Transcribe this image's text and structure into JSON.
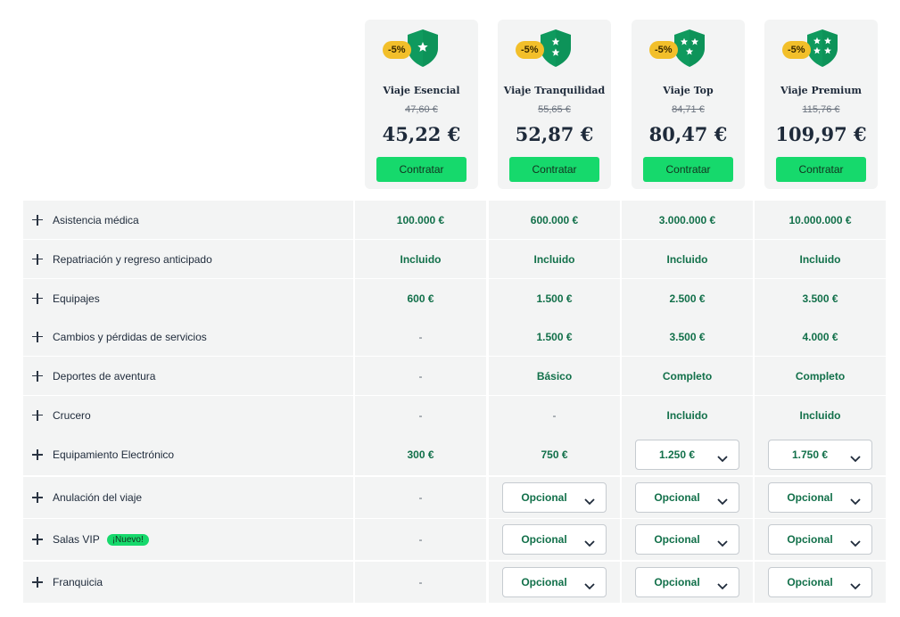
{
  "plans": [
    {
      "discount": "-5%",
      "icon": "shield-one-star-icon",
      "name": "Viaje Esencial",
      "old_price": "47,60 €",
      "price": "45,22 €",
      "cta": "Contratar"
    },
    {
      "discount": "-5%",
      "icon": "shield-two-stars-icon",
      "name": "Viaje Tranquilidad",
      "old_price": "55,65 €",
      "price": "52,87 €",
      "cta": "Contratar"
    },
    {
      "discount": "-5%",
      "icon": "shield-three-stars-icon",
      "name": "Viaje Top",
      "old_price": "84,71 €",
      "price": "80,47 €",
      "cta": "Contratar"
    },
    {
      "discount": "-5%",
      "icon": "shield-four-stars-icon",
      "name": "Viaje Premium",
      "old_price": "115,76 €",
      "price": "109,97 €",
      "cta": "Contratar"
    }
  ],
  "colors": {
    "accent": "#16d96c",
    "badge": "#f2bf2a",
    "value_text": "#12704a",
    "shield": "#0f9a5e"
  },
  "coverages": [
    {
      "label": "Asistencia médica",
      "values": [
        "100.000 €",
        "600.000 €",
        "3.000.000 €",
        "10.000.000 €"
      ]
    },
    {
      "label": "Repatriación y regreso anticipado",
      "values": [
        "Incluido",
        "Incluido",
        "Incluido",
        "Incluido"
      ]
    },
    {
      "label": "Equipajes",
      "values": [
        "600 €",
        "1.500 €",
        "2.500 €",
        "3.500 €"
      ]
    },
    {
      "label": "Cambios y pérdidas de servicios",
      "values": [
        "-",
        "1.500 €",
        "3.500 €",
        "4.000 €"
      ]
    },
    {
      "label": "Deportes de aventura",
      "values": [
        "-",
        "Básico",
        "Completo",
        "Completo"
      ]
    },
    {
      "label": "Crucero",
      "values": [
        "-",
        "-",
        "Incluido",
        "Incluido"
      ]
    },
    {
      "label": "Equipamiento Electrónico",
      "values": [
        "300 €",
        "750 €",
        {
          "select": "1.250 €"
        },
        {
          "select": "1.750 €"
        }
      ]
    },
    {
      "label": "Anulación del viaje",
      "values": [
        "-",
        {
          "select": "Opcional"
        },
        {
          "select": "Opcional"
        },
        {
          "select": "Opcional"
        }
      ]
    },
    {
      "label": "Salas VIP",
      "badge": "¡Nuevo!",
      "values": [
        "-",
        {
          "select": "Opcional"
        },
        {
          "select": "Opcional"
        },
        {
          "select": "Opcional"
        }
      ]
    },
    {
      "label": "Franquicia",
      "values": [
        "-",
        {
          "select": "Opcional"
        },
        {
          "select": "Opcional"
        },
        {
          "select": "Opcional"
        }
      ]
    }
  ]
}
